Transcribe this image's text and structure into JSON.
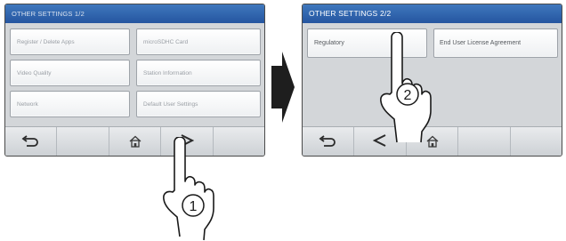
{
  "screens": [
    {
      "title": "OTHER SETTINGS 1/2",
      "buttons": [
        "Register / Delete Apps",
        "microSDHC Card",
        "Video Quality",
        "Station Information",
        "Network",
        "Default User Settings"
      ]
    },
    {
      "title": "OTHER SETTINGS 2/2",
      "buttons": [
        "Regulatory",
        "End User License Agreement"
      ]
    }
  ],
  "nav": {
    "back_icon": "back-icon",
    "home_icon": "home-icon",
    "next_icon": "next-page-icon",
    "prev_icon": "previous-page-icon"
  },
  "callouts": {
    "step1": "1",
    "step2": "2"
  },
  "colors": {
    "titlebar": "#2f64ad",
    "screen_bg": "#d3d6d9",
    "arrow": "#1e1e1e"
  }
}
